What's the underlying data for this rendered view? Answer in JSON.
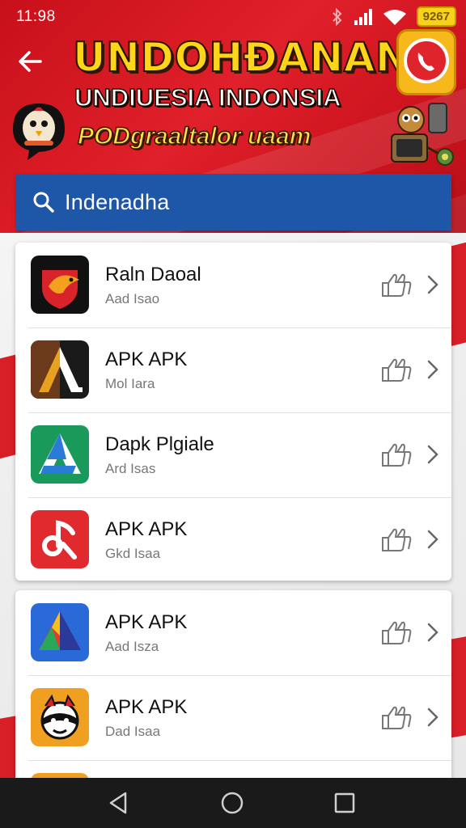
{
  "status_bar": {
    "time": "11:98",
    "battery_label": "9267"
  },
  "header": {
    "title": "UNDOHĐANAN",
    "subtitle": "UNDIUESIA INDONSIA",
    "tagline": "PODgraaltalor uaam"
  },
  "search": {
    "value": "Indenadha"
  },
  "apps": [
    {
      "name": "Raln Daoal",
      "subtitle": "Aad Isao",
      "icon": "red-shield-bird-icon"
    },
    {
      "name": "APK APK",
      "subtitle": "Mol Iara",
      "icon": "triangle-a-icon"
    },
    {
      "name": "Dapk Plgiale",
      "subtitle": "Ard Isas",
      "icon": "green-a-icon"
    },
    {
      "name": "APK APK",
      "subtitle": "Gkd Isaa",
      "icon": "red-music-icon"
    },
    {
      "name": "APK APK",
      "subtitle": "Aad Isza",
      "icon": "colorful-triangle-icon"
    },
    {
      "name": "APK APK",
      "subtitle": "Dad Isaa",
      "icon": "mask-character-icon"
    }
  ],
  "colors": {
    "header_red": "#d81e26",
    "search_blue": "#1e56a8",
    "title_yellow": "#ffd51a",
    "nav_dark": "#1a1a1a"
  }
}
